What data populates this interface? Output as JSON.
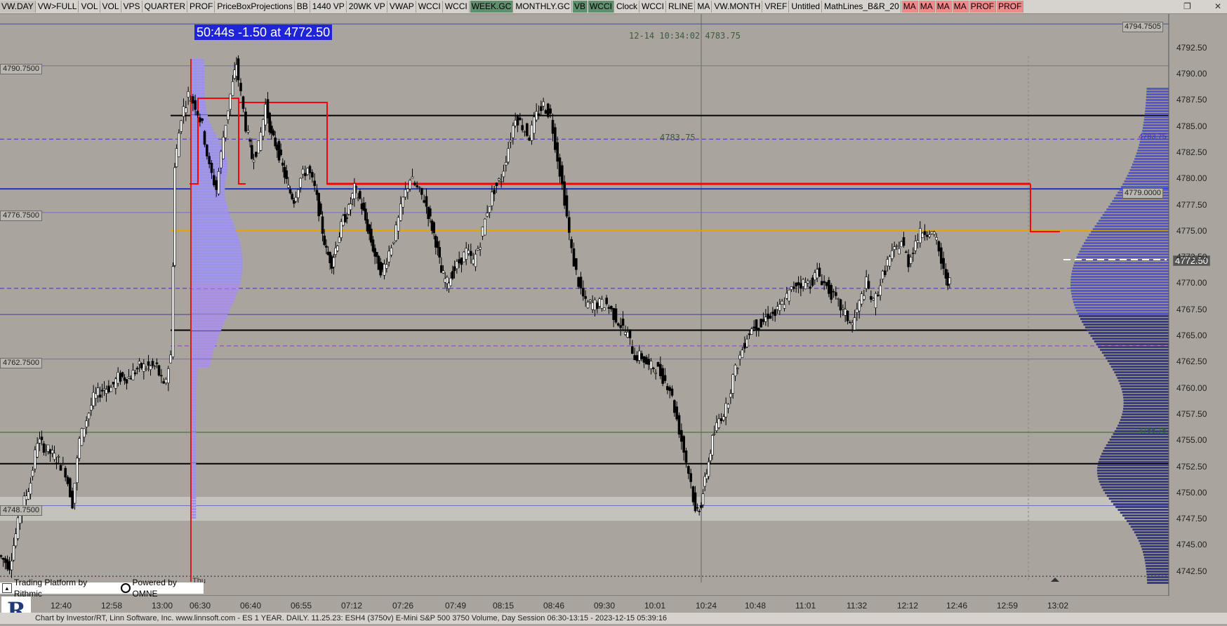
{
  "toolbar": {
    "buttons": [
      {
        "label": "VW.DAY",
        "style": "first"
      },
      {
        "label": "VW>FULL",
        "style": ""
      },
      {
        "label": "VOL",
        "style": ""
      },
      {
        "label": "VOL",
        "style": ""
      },
      {
        "label": "VPS",
        "style": ""
      },
      {
        "label": "QUARTER",
        "style": ""
      },
      {
        "label": "PROF",
        "style": ""
      },
      {
        "label": "PriceBoxProjections",
        "style": ""
      },
      {
        "label": "BB",
        "style": ""
      },
      {
        "label": "1440 VP",
        "style": ""
      },
      {
        "label": "20WK VP",
        "style": ""
      },
      {
        "label": "VWAP",
        "style": ""
      },
      {
        "label": "WCCI",
        "style": ""
      },
      {
        "label": "WCCI",
        "style": ""
      },
      {
        "label": "WEEK.GC",
        "style": "green"
      },
      {
        "label": "MONTHLY.GC",
        "style": ""
      },
      {
        "label": "VB",
        "style": "green"
      },
      {
        "label": "WCCI",
        "style": "green"
      },
      {
        "label": "Clock",
        "style": ""
      },
      {
        "label": "WCCI",
        "style": ""
      },
      {
        "label": "RLINE",
        "style": ""
      },
      {
        "label": "MA",
        "style": ""
      },
      {
        "label": "VW.MONTH",
        "style": ""
      },
      {
        "label": "VREF",
        "style": ""
      },
      {
        "label": "Untitled",
        "style": ""
      },
      {
        "label": "MathLines_B&R_20",
        "style": ""
      },
      {
        "label": "MA",
        "style": "pink"
      },
      {
        "label": "MA",
        "style": "pink"
      },
      {
        "label": "MA",
        "style": "pink"
      },
      {
        "label": "MA",
        "style": "pink"
      },
      {
        "label": "PROF",
        "style": "pink"
      },
      {
        "label": "PROF",
        "style": "pink"
      }
    ],
    "window_icons": {
      "restore": "restore-icon",
      "close": "close-icon"
    }
  },
  "header": {
    "timer": "50:44s  -1.50 at 4772.50",
    "timestamp": "12-14 10:34:02 4783.75",
    "mid_label": "4783.75",
    "thu_label": "Thu"
  },
  "left_labels": [
    "4790.7500",
    "4776.7500",
    "4762.7500",
    "4748.7500"
  ],
  "right_labels": {
    "top": "4794.7505",
    "blue": "4779.0000",
    "current": "4772.50",
    "purple": "4783.75",
    "green": "4755.75"
  },
  "y_axis": [
    "4792.50",
    "4790.00",
    "4787.50",
    "4785.00",
    "4782.50",
    "4780.00",
    "4777.50",
    "4775.00",
    "4772.50",
    "4770.00",
    "4767.50",
    "4765.00",
    "4762.50",
    "4760.00",
    "4757.50",
    "4755.00",
    "4752.50",
    "4750.00",
    "4747.50",
    "4745.00",
    "4742.50"
  ],
  "x_axis": [
    "12:40",
    "12:58",
    "13:00",
    "06:30",
    "06:40",
    "06:55",
    "07:12",
    "07:26",
    "07:49",
    "08:15",
    "08:46",
    "09:30",
    "10:01",
    "10:24",
    "10:48",
    "11:01",
    "11:32",
    "12:12",
    "12:46",
    "12:59",
    "13:02"
  ],
  "chart_data": {
    "type": "candlestick",
    "instrument": "ESH4 (3750v) E-Mini S&P 500 3750 Volume",
    "ylim": [
      4741.5,
      4795.5
    ],
    "price_path": [
      [
        0,
        4744
      ],
      [
        15,
        4743
      ],
      [
        30,
        4748
      ],
      [
        45,
        4751
      ],
      [
        55,
        4755
      ],
      [
        70,
        4754
      ],
      [
        85,
        4753
      ],
      [
        95,
        4752
      ],
      [
        105,
        4749
      ],
      [
        115,
        4755
      ],
      [
        125,
        4757
      ],
      [
        135,
        4759
      ],
      [
        150,
        4760
      ],
      [
        160,
        4760
      ],
      [
        170,
        4761
      ],
      [
        185,
        4761
      ],
      [
        200,
        4762
      ],
      [
        210,
        4762
      ],
      [
        225,
        4762
      ],
      [
        235,
        4760
      ],
      [
        245,
        4763
      ],
      [
        250,
        4781
      ],
      [
        260,
        4786
      ],
      [
        270,
        4788
      ],
      [
        280,
        4787
      ],
      [
        290,
        4785
      ],
      [
        300,
        4781
      ],
      [
        310,
        4779
      ],
      [
        320,
        4784
      ],
      [
        330,
        4788
      ],
      [
        338,
        4791
      ],
      [
        345,
        4788
      ],
      [
        352,
        4785
      ],
      [
        360,
        4782
      ],
      [
        370,
        4783
      ],
      [
        380,
        4787
      ],
      [
        388,
        4784
      ],
      [
        396,
        4783
      ],
      [
        404,
        4781
      ],
      [
        412,
        4779
      ],
      [
        420,
        4778
      ],
      [
        430,
        4780
      ],
      [
        440,
        4781
      ],
      [
        450,
        4779
      ],
      [
        458,
        4776
      ],
      [
        466,
        4773
      ],
      [
        474,
        4772
      ],
      [
        482,
        4774
      ],
      [
        490,
        4776
      ],
      [
        498,
        4777
      ],
      [
        506,
        4779
      ],
      [
        514,
        4778
      ],
      [
        522,
        4776
      ],
      [
        530,
        4774
      ],
      [
        538,
        4772
      ],
      [
        546,
        4771
      ],
      [
        556,
        4773
      ],
      [
        566,
        4775
      ],
      [
        576,
        4778
      ],
      [
        586,
        4780
      ],
      [
        596,
        4779
      ],
      [
        606,
        4778
      ],
      [
        614,
        4776
      ],
      [
        622,
        4774
      ],
      [
        630,
        4771
      ],
      [
        638,
        4770
      ],
      [
        646,
        4771
      ],
      [
        656,
        4772
      ],
      [
        666,
        4773
      ],
      [
        676,
        4772
      ],
      [
        686,
        4774
      ],
      [
        696,
        4777
      ],
      [
        706,
        4779
      ],
      [
        716,
        4780
      ],
      [
        726,
        4783
      ],
      [
        736,
        4786
      ],
      [
        746,
        4785
      ],
      [
        756,
        4784
      ],
      [
        766,
        4786
      ],
      [
        776,
        4787
      ],
      [
        786,
        4786
      ],
      [
        796,
        4782
      ],
      [
        806,
        4778
      ],
      [
        816,
        4773
      ],
      [
        826,
        4770
      ],
      [
        836,
        4768
      ],
      [
        846,
        4768
      ],
      [
        856,
        4768
      ],
      [
        866,
        4768
      ],
      [
        876,
        4767
      ],
      [
        886,
        4766
      ],
      [
        896,
        4765
      ],
      [
        906,
        4763
      ],
      [
        916,
        4763
      ],
      [
        926,
        4762
      ],
      [
        936,
        4762
      ],
      [
        946,
        4761
      ],
      [
        956,
        4760
      ],
      [
        966,
        4757
      ],
      [
        976,
        4754
      ],
      [
        986,
        4751
      ],
      [
        992,
        4748
      ],
      [
        1000,
        4749
      ],
      [
        1008,
        4752
      ],
      [
        1016,
        4755
      ],
      [
        1026,
        4757
      ],
      [
        1036,
        4758
      ],
      [
        1046,
        4761
      ],
      [
        1056,
        4763
      ],
      [
        1066,
        4765
      ],
      [
        1076,
        4766
      ],
      [
        1086,
        4766
      ],
      [
        1096,
        4767
      ],
      [
        1106,
        4767
      ],
      [
        1116,
        4768
      ],
      [
        1126,
        4769
      ],
      [
        1136,
        4770
      ],
      [
        1146,
        4770
      ],
      [
        1156,
        4770
      ],
      [
        1166,
        4771
      ],
      [
        1176,
        4770
      ],
      [
        1186,
        4769
      ],
      [
        1196,
        4768
      ],
      [
        1206,
        4767
      ],
      [
        1216,
        4766
      ],
      [
        1226,
        4768
      ],
      [
        1236,
        4770
      ],
      [
        1246,
        4768
      ],
      [
        1256,
        4770
      ],
      [
        1266,
        4772
      ],
      [
        1276,
        4773
      ],
      [
        1286,
        4774
      ],
      [
        1296,
        4772
      ],
      [
        1306,
        4774
      ],
      [
        1316,
        4775
      ],
      [
        1326,
        4775
      ],
      [
        1336,
        4774
      ],
      [
        1346,
        4771
      ],
      [
        1354,
        4770
      ]
    ],
    "levels": [
      {
        "price": 4794.75,
        "color": "#4a4aa0",
        "style": "solid",
        "from": 0
      },
      {
        "price": 4790.75,
        "color": "#7070c0",
        "style": "solid",
        "from": 0
      },
      {
        "price": 4786.0,
        "color": "#000000",
        "style": "solid",
        "from": 243
      },
      {
        "price": 4783.75,
        "color": "#5522cc",
        "style": "dashed",
        "from": 0
      },
      {
        "price": 4779.0,
        "color": "#2233cc",
        "style": "solid",
        "from": 0
      },
      {
        "price": 4776.75,
        "color": "#7070c0",
        "style": "solid",
        "from": 0
      },
      {
        "price": 4775.0,
        "color": "#e0a800",
        "style": "solid",
        "from": 243
      },
      {
        "price": 4769.5,
        "color": "#5522cc",
        "style": "dashed",
        "from": 0
      },
      {
        "price": 4767.0,
        "color": "#4a3f8f",
        "style": "solid",
        "from": 0
      },
      {
        "price": 4765.5,
        "color": "#000000",
        "style": "solid",
        "from": 243
      },
      {
        "price": 4764.0,
        "color": "#8a3fd0",
        "style": "dashed",
        "from": 243
      },
      {
        "price": 4762.75,
        "color": "#7070c0",
        "style": "solid",
        "from": 0
      },
      {
        "price": 4755.75,
        "color": "#2a6a2a",
        "style": "solid",
        "from": 0
      },
      {
        "price": 4752.75,
        "color": "#000000",
        "style": "solid",
        "from": 0
      },
      {
        "price": 4748.75,
        "color": "#7070c0",
        "style": "solid",
        "from": 0
      },
      {
        "price": 4742.0,
        "color": "#222222",
        "style": "dotted",
        "from": 0
      }
    ]
  },
  "rithmic": {
    "text": "Trading Platform by Rithmic",
    "powered": "Powered by OMNE"
  },
  "footer": {
    "text": "Chart by Investor/RT, Linn Software, Inc. www.linnsoft.com - ES 1 YEAR. DAILY.    11.25.23: ESH4 (3750v) E-Mini S&P 500 3750 Volume, Day Session 06:30-13:15 - 2023-12-15 05:39:16"
  }
}
